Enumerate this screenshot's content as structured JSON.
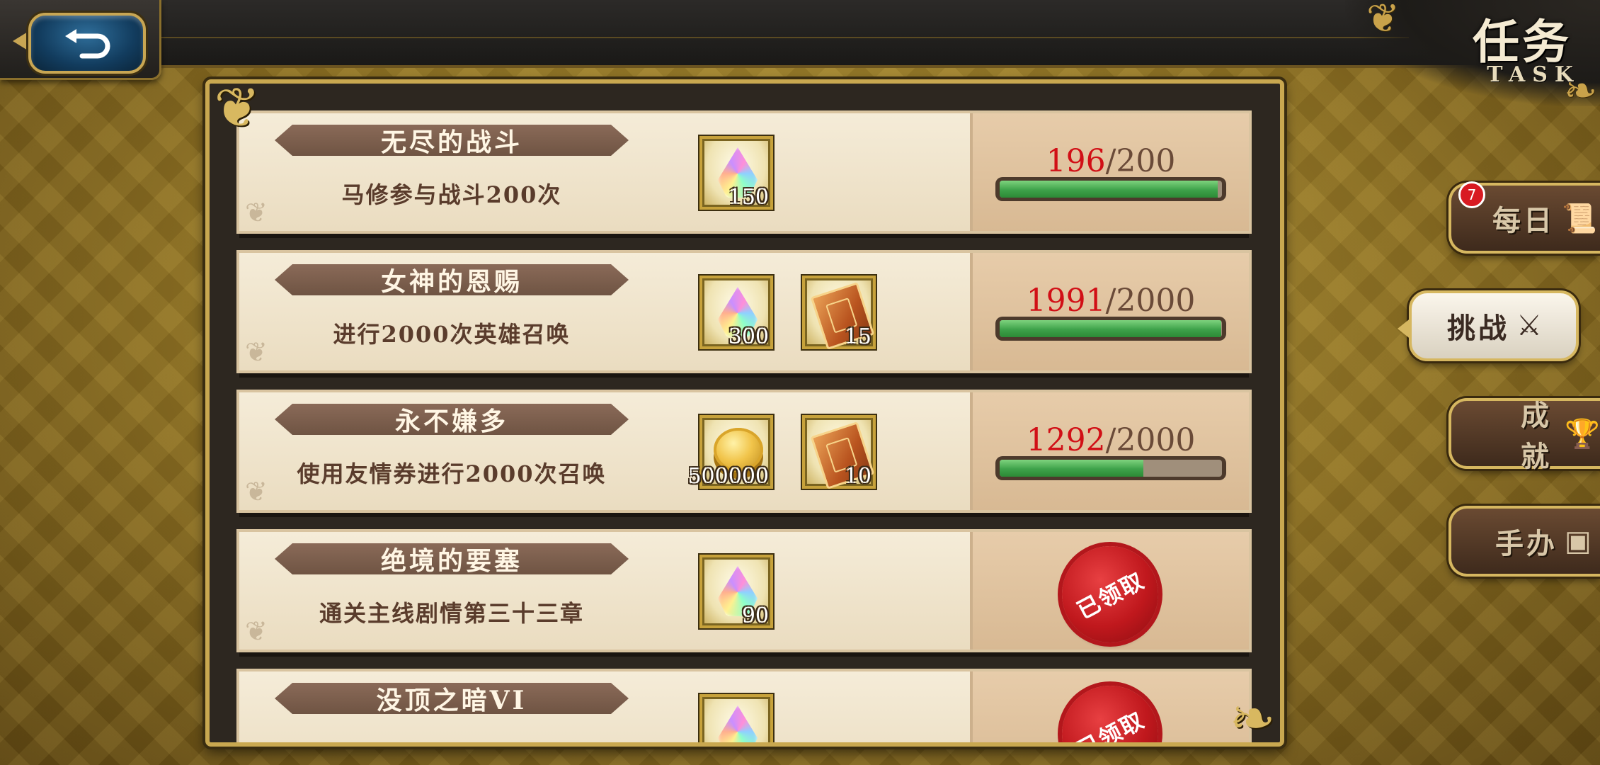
{
  "header": {
    "title_cn": "任务",
    "title_en": "TASK"
  },
  "tasks": [
    {
      "title": "无尽的战斗",
      "desc": "马修参与战斗200次",
      "rewards": [
        {
          "icon": "rainbow-gem-icon",
          "count": "150"
        }
      ],
      "progress": {
        "current": "196",
        "total": "/200",
        "fraction": 0.98
      },
      "claimed": false
    },
    {
      "title": "女神的恩赐",
      "desc": "进行2000次英雄召唤",
      "rewards": [
        {
          "icon": "rainbow-gem-icon",
          "count": "300"
        },
        {
          "icon": "summon-ticket-icon",
          "count": "15"
        }
      ],
      "progress": {
        "current": "1991",
        "total": "/2000",
        "fraction": 0.9955
      },
      "claimed": false
    },
    {
      "title": "永不嫌多",
      "desc": "使用友情券进行2000次召唤",
      "rewards": [
        {
          "icon": "gold-coin-icon",
          "count": "500000"
        },
        {
          "icon": "summon-ticket-icon",
          "count": "10"
        }
      ],
      "progress": {
        "current": "1292",
        "total": "/2000",
        "fraction": 0.646
      },
      "claimed": false
    },
    {
      "title": "绝境的要塞",
      "desc": "通关主线剧情第三十三章",
      "rewards": [
        {
          "icon": "rainbow-gem-icon",
          "count": "90"
        }
      ],
      "claimed": true,
      "claimed_label": "已领取"
    },
    {
      "title": "没顶之暗VI",
      "desc": "",
      "rewards": [
        {
          "icon": "rainbow-gem-icon",
          "count": ""
        }
      ],
      "claimed": true,
      "claimed_label": "已领取"
    }
  ],
  "tabs": [
    {
      "label": "每日",
      "icon": "scroll-icon",
      "badge": "7",
      "active": false
    },
    {
      "label": "挑战",
      "icon": "crossed-swords-icon",
      "active": true
    },
    {
      "label": "成就",
      "icon": "trophy-icon",
      "active": false
    },
    {
      "label": "手办",
      "icon": "figure-card-icon",
      "active": false
    }
  ],
  "colors": {
    "progress_current": "#d10f16",
    "bar_fill": "#3ea24a",
    "seal": "#c0181d",
    "frame_gold": "#c9a850"
  }
}
